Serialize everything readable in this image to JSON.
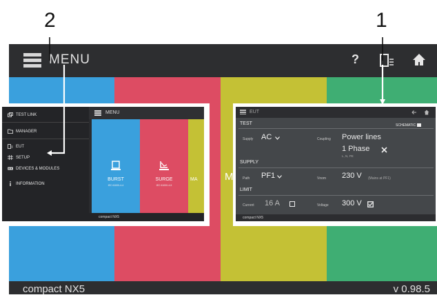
{
  "callouts": {
    "left": "2",
    "right": "1"
  },
  "topbar": {
    "menu_label": "MENU",
    "help_label": "?",
    "icons": [
      "menu-icon",
      "eut-icon",
      "home-icon"
    ]
  },
  "center_fragment": "M",
  "bottombar": {
    "product": "compact NX5",
    "version": "v 0.98.5"
  },
  "colors": {
    "blue": "#3aa0dd",
    "red": "#dd4c63",
    "olive": "#c4c135",
    "green": "#3fae73",
    "bar": "#2d2e30"
  },
  "menu_screen": {
    "sidebar": [
      {
        "label": "TEST LINK",
        "icon": "link-icon"
      },
      {
        "label": "MANAGER",
        "icon": "folder-icon"
      },
      {
        "label": "EUT",
        "icon": "eut-icon"
      },
      {
        "label": "SETUP",
        "icon": "setup-icon"
      },
      {
        "label": "DEVICES & MODULES",
        "icon": "devices-icon"
      },
      {
        "label": "INFORMATION",
        "icon": "info-icon"
      }
    ],
    "header": "MENU",
    "tiles": [
      {
        "name": "BURST",
        "standard": "IEC 61000-4-4"
      },
      {
        "name": "SURGE",
        "standard": "IEC 61000-4-5"
      },
      {
        "name": "MA"
      }
    ],
    "footer": "compact NX5"
  },
  "eut_screen": {
    "header": "EUT",
    "test_title": "TEST",
    "schematic": "SCHEMATIC",
    "supply_label": "Supply",
    "supply_value": "AC",
    "coupling_label": "Coupling",
    "coupling_value": "Power lines",
    "phase_value": "1 Phase",
    "phase_lines": "L, N, PE",
    "supply_title": "SUPPLY",
    "path_label": "Path",
    "path_value": "PF1",
    "vnom_label": "Vnom",
    "vnom_value": "230 V",
    "vnom_note": "(Mains at PF1)",
    "limit_title": "LIMIT",
    "current_label": "Current",
    "current_value": "16 A",
    "voltage_label": "Voltage",
    "voltage_value": "300 V",
    "footer": "compact NX5"
  }
}
